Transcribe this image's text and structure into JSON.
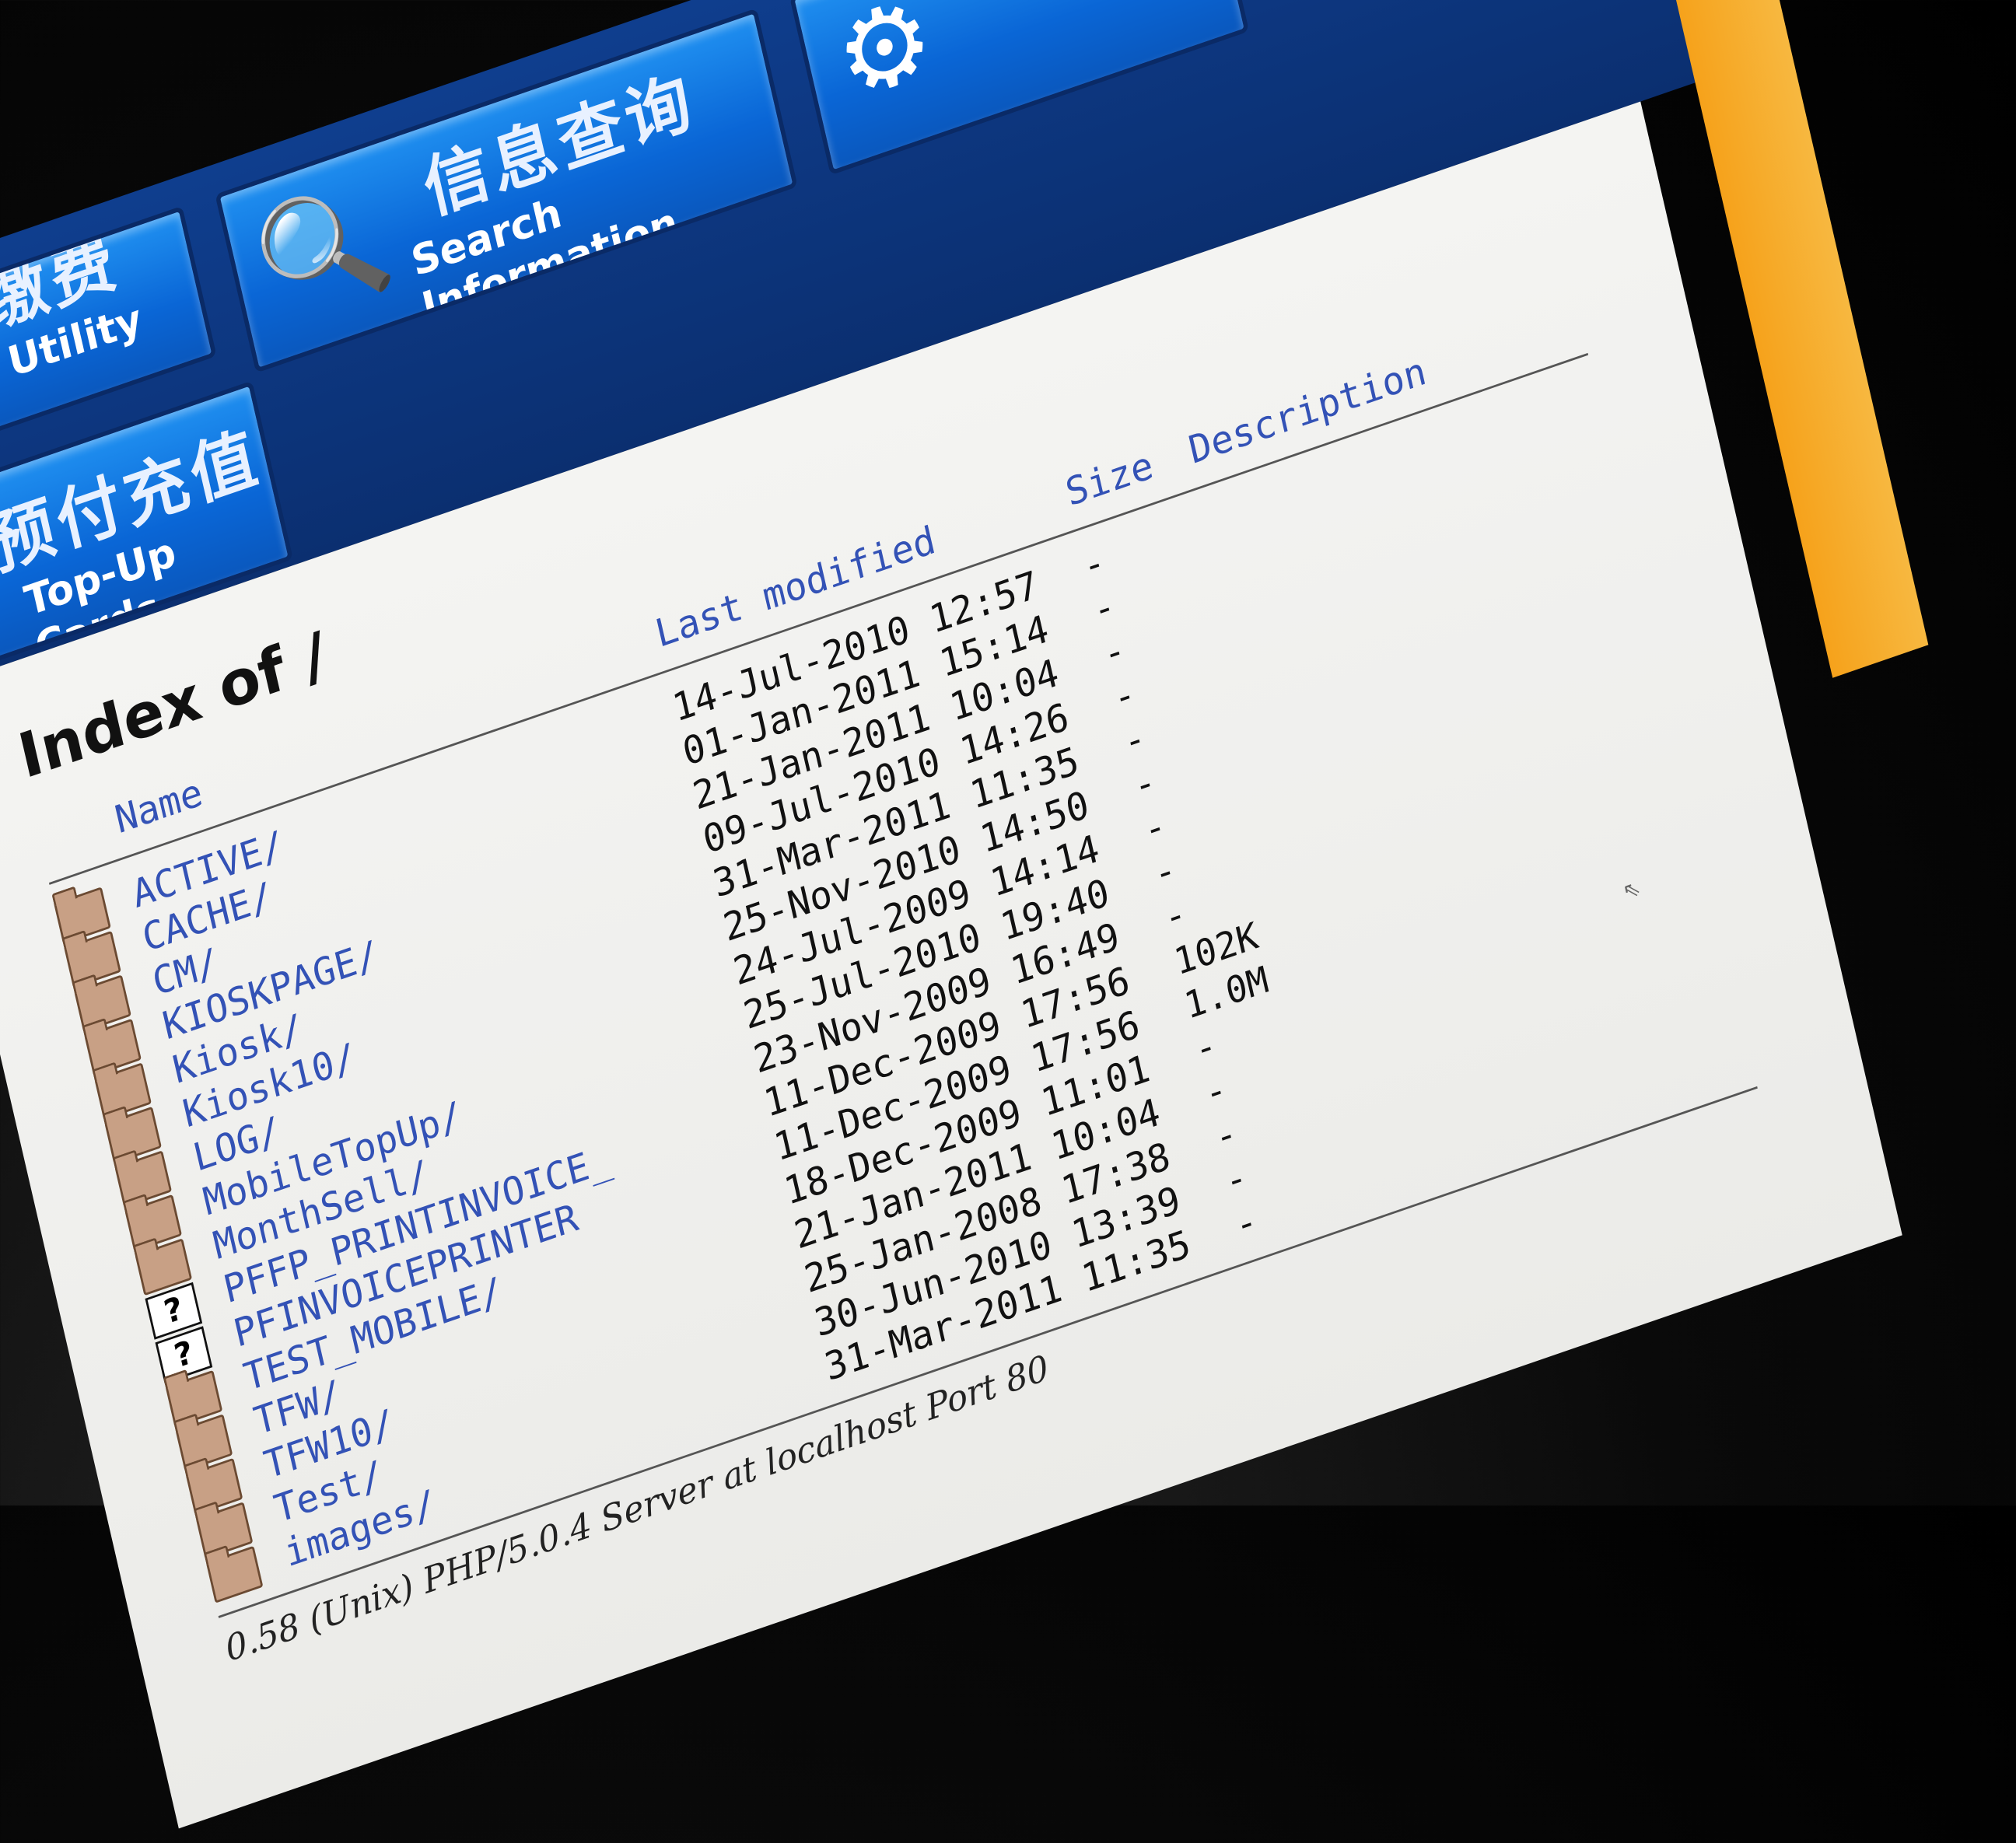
{
  "kiosk": {
    "tiles": [
      {
        "zh": "公共缴费",
        "en": "Public Utility Bills",
        "icon": "bills-icon"
      },
      {
        "zh": "信息查询",
        "en": "Search Information",
        "icon": "magnifier-document-icon"
      },
      {
        "zh": "预付充值",
        "en": "Top-Up Cards",
        "icon": "money-icon"
      }
    ]
  },
  "listing": {
    "title": "Index of /",
    "columns": {
      "name": "Name",
      "last_modified": "Last modified",
      "size": "Size",
      "description": "Description"
    },
    "rows": [
      {
        "name": "ACTIVE/",
        "modified": "14-Jul-2010 12:57",
        "size": "-",
        "icon": "folder-icon"
      },
      {
        "name": "CACHE/",
        "modified": "01-Jan-2011 15:14",
        "size": "-",
        "icon": "folder-icon"
      },
      {
        "name": "CM/",
        "modified": "21-Jan-2011 10:04",
        "size": "-",
        "icon": "folder-icon"
      },
      {
        "name": "KIOSKPAGE/",
        "modified": "09-Jul-2010 14:26",
        "size": "-",
        "icon": "folder-icon"
      },
      {
        "name": "Kiosk/",
        "modified": "31-Mar-2011 11:35",
        "size": "-",
        "icon": "folder-icon"
      },
      {
        "name": "Kiosk10/",
        "modified": "25-Nov-2010 14:50",
        "size": "-",
        "icon": "folder-icon"
      },
      {
        "name": "LOG/",
        "modified": "24-Jul-2009 14:14",
        "size": "-",
        "icon": "folder-icon"
      },
      {
        "name": "MobileTopUp/",
        "modified": "25-Jul-2010 19:40",
        "size": "-",
        "icon": "folder-icon"
      },
      {
        "name": "MonthSell/",
        "modified": "23-Nov-2009 16:49",
        "size": "-",
        "icon": "folder-icon"
      },
      {
        "name": "PFFP_PRINTINVOICE_",
        "modified": "11-Dec-2009 17:56",
        "size": "102K",
        "icon": "unknown-file-icon"
      },
      {
        "name": "PFINVOICEPRINTER",
        "modified": "11-Dec-2009 17:56",
        "size": "1.0M",
        "icon": "unknown-file-icon"
      },
      {
        "name": "TEST_MOBILE/",
        "modified": "18-Dec-2009 11:01",
        "size": "-",
        "icon": "folder-icon"
      },
      {
        "name": "TFW/",
        "modified": "21-Jan-2011 10:04",
        "size": "-",
        "icon": "folder-icon"
      },
      {
        "name": "TFW10/",
        "modified": "25-Jan-2008 17:38",
        "size": "-",
        "icon": "folder-icon"
      },
      {
        "name": "Test/",
        "modified": "30-Jun-2010 13:39",
        "size": "-",
        "icon": "folder-icon"
      },
      {
        "name": "images/",
        "modified": "31-Mar-2011 11:35",
        "size": "-",
        "icon": "folder-icon"
      }
    ],
    "footer": "0.58 (Unix) PHP/5.0.4 Server at localhost Port 80"
  }
}
